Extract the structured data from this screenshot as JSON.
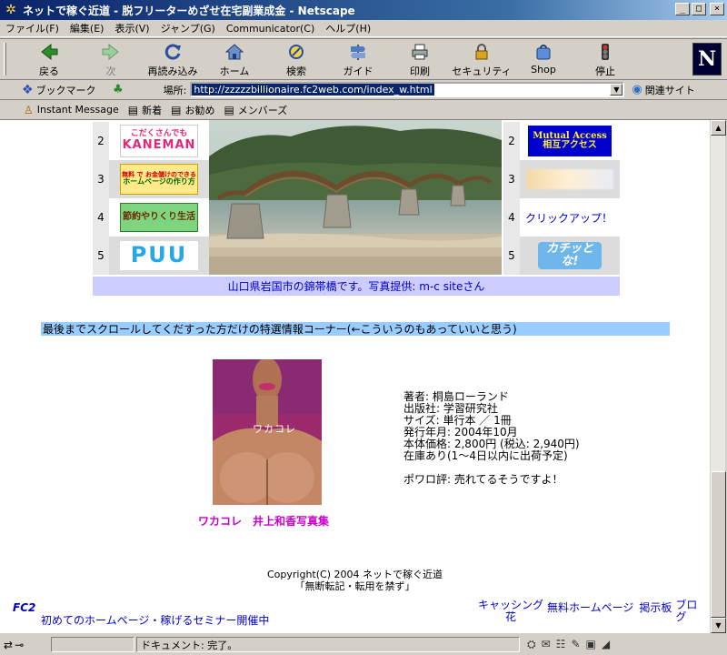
{
  "window": {
    "title": "ネットで稼ぐ近道 - 脱フリーターめざせ在宅副業成金 - Netscape",
    "minimize": "_",
    "maximize": "□",
    "close": "×"
  },
  "menu": {
    "items": [
      "ファイル(F)",
      "編集(E)",
      "表示(V)",
      "ジャンプ(G)",
      "Communicator(C)",
      "ヘルプ(H)"
    ]
  },
  "toolbar": {
    "buttons": [
      {
        "label": "戻る",
        "icon": "back-arrow-icon"
      },
      {
        "label": "次",
        "icon": "forward-arrow-icon"
      },
      {
        "label": "再読み込み",
        "icon": "reload-icon"
      },
      {
        "label": "ホーム",
        "icon": "home-icon"
      },
      {
        "label": "検索",
        "icon": "search-icon"
      },
      {
        "label": "ガイド",
        "icon": "guide-icon"
      },
      {
        "label": "印刷",
        "icon": "print-icon"
      },
      {
        "label": "セキュリティ",
        "icon": "security-lock-icon"
      },
      {
        "label": "Shop",
        "icon": "shop-icon"
      },
      {
        "label": "停止",
        "icon": "stop-icon"
      }
    ],
    "brand": "N"
  },
  "location": {
    "bookmark_label": "ブックマーク",
    "label": "場所:",
    "url": "http://zzzzzbillionaire.fc2web.com/index_w.html",
    "related_label": "関連サイト"
  },
  "personal": {
    "items": [
      "Instant Message",
      "新着",
      "お勧め",
      "メンバーズ"
    ]
  },
  "banners": {
    "rows": [
      "2",
      "3",
      "4",
      "5"
    ],
    "left": [
      {
        "line1": "こだくさんでも",
        "line2": "KANEMAN"
      },
      {
        "line1": "無料 で お金儲けのできる",
        "line2": "ホームページの作り方"
      },
      {
        "line1": "節約やりくり生活"
      },
      {
        "line1": "PUU"
      }
    ],
    "right": [
      {
        "line1": "Mutual Access",
        "line2": "相互アクセス"
      },
      {
        "line1": ""
      },
      {
        "line1": "クリックアップ！"
      },
      {
        "line1": "カチッとな!"
      }
    ],
    "caption": "山口県岩国市の錦帯橋です。写真提供: m-c siteさん"
  },
  "special": {
    "text": "最後までスクロールしてくだすった方だけの特選情報コーナー(←こういうのもあっていいと思う)"
  },
  "book": {
    "cover_text": "ワカコレ",
    "title": "ワカコレ　井上和香写真集",
    "info": [
      "著者: 桐島ローランド",
      "出版社: 学習研究社",
      "サイズ: 単行本 ／ 1冊",
      "発行年月: 2004年10月",
      "本体価格: 2,800円 (税込: 2,940円)",
      "在庫あり(1〜4日以内に出荷予定)"
    ],
    "review": "ポワロ評: 売れてるそうですよ！"
  },
  "footer": {
    "copyright": "Copyright(C) 2004 ネットで稼ぐ近道",
    "notice": "「無断転記・転用を禁ず」",
    "fc2": "FC2",
    "seminar": "初めてのホームページ・稼げるセミナー開催中",
    "links": [
      "キャッシング花",
      "無料ホームページ",
      "掲示板",
      "ブログ"
    ]
  },
  "status": {
    "text": "ドキュメント: 完了。"
  },
  "colors": {
    "link": "#0000cc",
    "caption_bg": "#ccccff",
    "special_bg": "#99ccff",
    "book_title": "#cc00cc"
  }
}
